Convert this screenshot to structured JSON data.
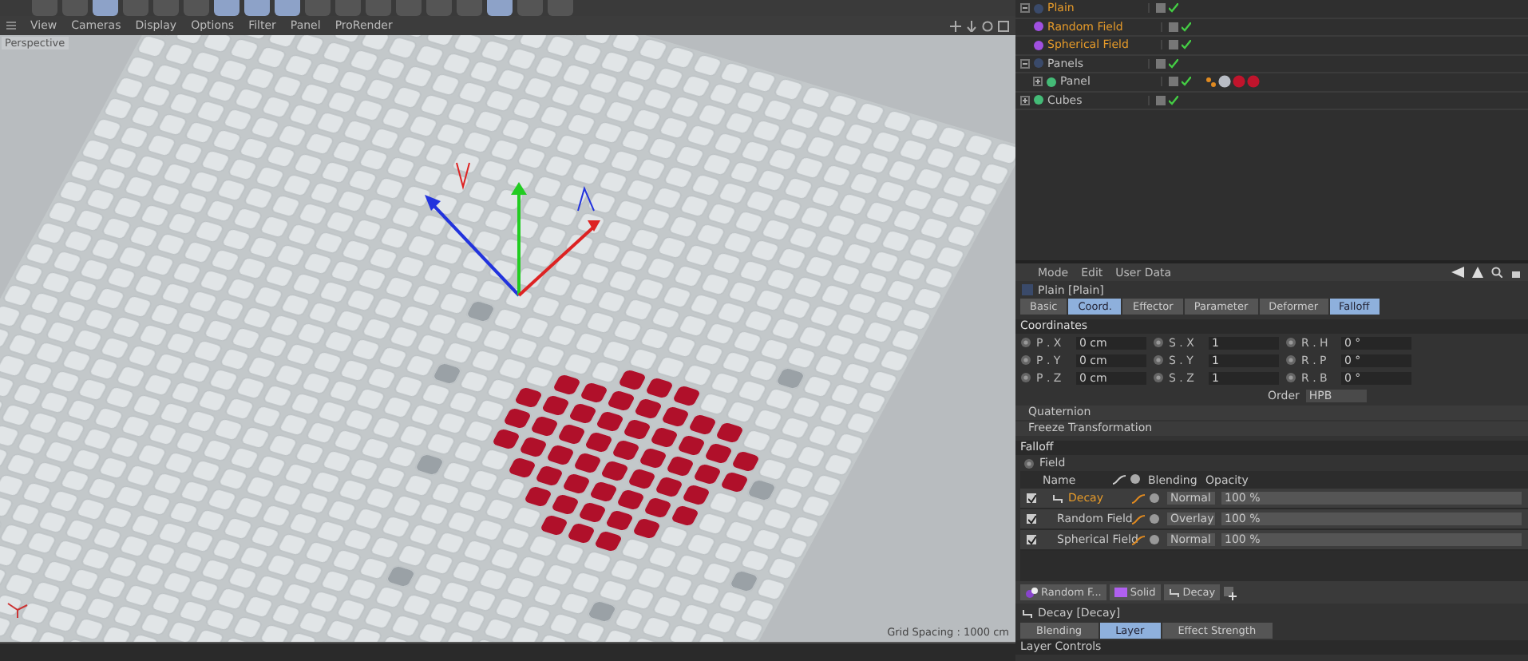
{
  "viewport": {
    "menu": [
      "View",
      "Cameras",
      "Display",
      "Options",
      "Filter",
      "Panel",
      "ProRender"
    ],
    "camera_label": "Perspective",
    "grid_spacing": "Grid Spacing : 1000 cm"
  },
  "object_manager": {
    "items": [
      {
        "name": "Plain",
        "selected": true,
        "enabled": true,
        "expanded": true,
        "children": [
          {
            "name": "Random Field",
            "selected": true,
            "enabled": true
          },
          {
            "name": "Spherical Field",
            "selected": true,
            "enabled": true
          }
        ]
      },
      {
        "name": "Panels",
        "selected": false,
        "enabled": true,
        "expanded": true,
        "children": [
          {
            "name": "Panel",
            "selected": false,
            "enabled": true,
            "expanded": false,
            "tags": [
              {
                "kind": "pivot"
              },
              {
                "kind": "material",
                "color": "#b8bcc4"
              },
              {
                "kind": "material",
                "color": "#c0142c"
              },
              {
                "kind": "material",
                "color": "#c0142c"
              }
            ]
          }
        ]
      },
      {
        "name": "Cubes",
        "selected": false,
        "enabled": true,
        "expanded": false
      }
    ]
  },
  "attributes": {
    "menu": [
      "Mode",
      "Edit",
      "User Data"
    ],
    "title": "Plain [Plain]",
    "tabs": [
      {
        "label": "Basic",
        "selected": false
      },
      {
        "label": "Coord.",
        "selected": true
      },
      {
        "label": "Effector",
        "selected": false
      },
      {
        "label": "Parameter",
        "selected": false
      },
      {
        "label": "Deformer",
        "selected": false
      },
      {
        "label": "Falloff",
        "selected": true
      }
    ],
    "coordinates": {
      "title": "Coordinates",
      "rows": [
        [
          {
            "label": "P . X",
            "value": "0 cm"
          },
          {
            "label": "S . X",
            "value": "1"
          },
          {
            "label": "R . H",
            "value": "0 °"
          }
        ],
        [
          {
            "label": "P . Y",
            "value": "0 cm"
          },
          {
            "label": "S . Y",
            "value": "1"
          },
          {
            "label": "R . P",
            "value": "0 °"
          }
        ],
        [
          {
            "label": "P . Z",
            "value": "0 cm"
          },
          {
            "label": "S . Z",
            "value": "1"
          },
          {
            "label": "R . B",
            "value": "0 °"
          }
        ]
      ],
      "order_label": "Order",
      "order": "HPB"
    },
    "groups": [
      "Quaternion",
      "Freeze Transformation"
    ],
    "falloff": {
      "title": "Falloff",
      "field_label": "Field",
      "columns": [
        "Name",
        "Blending",
        "Opacity"
      ],
      "rows": [
        {
          "name": "Decay",
          "kind": "decay",
          "selected": true,
          "checked": true,
          "blending": "Normal",
          "opacity": "100 %",
          "level": 1
        },
        {
          "name": "Random Field",
          "kind": "random",
          "selected": false,
          "checked": true,
          "blending": "Overlay",
          "opacity": "100 %",
          "level": 1
        },
        {
          "name": "Spherical Field",
          "kind": "spherical",
          "selected": false,
          "checked": true,
          "blending": "Normal",
          "opacity": "100 %",
          "level": 1
        }
      ]
    },
    "layer_bar": [
      {
        "label": "Random F...",
        "kind": "random"
      },
      {
        "label": "Solid",
        "kind": "solid"
      },
      {
        "label": "Decay",
        "kind": "decay"
      }
    ],
    "layer_title": "Decay [Decay]",
    "layer_tabs": [
      {
        "label": "Blending",
        "selected": false
      },
      {
        "label": "Layer",
        "selected": true
      },
      {
        "label": "Effect Strength",
        "selected": false
      }
    ],
    "layer_controls": "Layer Controls"
  }
}
